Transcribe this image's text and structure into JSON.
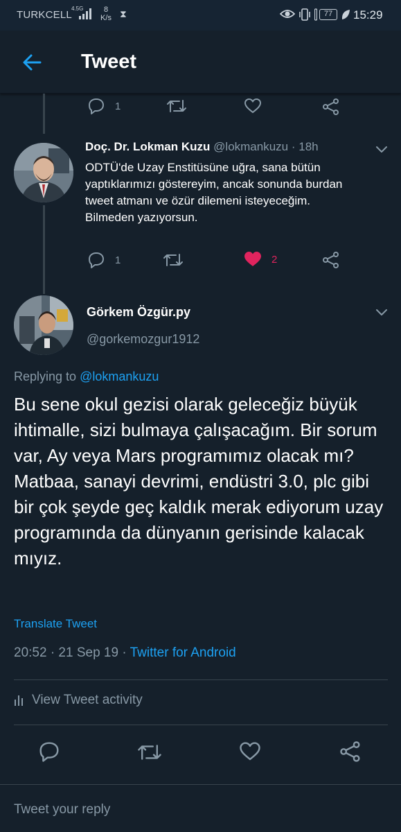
{
  "status_bar": {
    "carrier": "TURKCELL",
    "network": "4.5G",
    "speed_value": "8",
    "speed_unit": "K/s",
    "battery": "77",
    "time": "15:29"
  },
  "header": {
    "title": "Tweet"
  },
  "prev_actions": {
    "reply_count": "1"
  },
  "reply_tweet": {
    "name": "Doç. Dr. Lokman Kuzu",
    "handle": "@lokmankuzu",
    "time": "· 18h",
    "text": "ODTÜ'de Uzay Enstitüsüne uğra, sana bütün yaptıklarımızı göstereyim, ancak sonunda burdan tweet atmanı ve özür dilemeni isteyeceğim. Bilmeden yazıyorsun.",
    "reply_count": "1",
    "like_count": "2"
  },
  "main_tweet": {
    "name": "Görkem Özgür.py",
    "handle": "@gorkemozgur1912",
    "replying_prefix": "Replying to",
    "replying_to": "@lokmankuzu",
    "text": "Bu sene okul gezisi olarak geleceğiz büyük ihtimalle, sizi bulmaya çalışacağım. Bir sorum var, Ay veya Mars programımız olacak mı? Matbaa, sanayi devrimi, endüstri 3.0, plc gibi bir çok şeyde geç kaldık merak ediyorum uzay programında da dünyanın gerisinde kalacak mıyız.",
    "translate_label": "Translate Tweet",
    "timestamp": "20:52 · 21 Sep 19 ·",
    "source": "Twitter for Android",
    "activity_label": "View Tweet activity"
  },
  "reply_box": {
    "placeholder": "Tweet your reply"
  },
  "colors": {
    "background": "#15202b",
    "accent": "#1da1f2",
    "muted": "#8899a6",
    "like": "#e0245e"
  },
  "icons": [
    "back-arrow-icon",
    "reply-icon",
    "retweet-icon",
    "like-icon",
    "share-icon",
    "chevron-down-icon",
    "activity-bars-icon"
  ]
}
